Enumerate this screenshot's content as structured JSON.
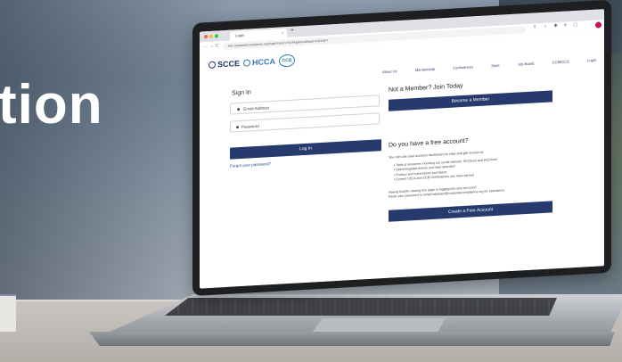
{
  "hero": {
    "word": "tion"
  },
  "browser": {
    "tab_title": "Login",
    "url": "hhc.corporatecompliance.org/login?return=%2Flogin&callback=HCANET",
    "nav_back": "←",
    "nav_forward": "→",
    "nav_reload": "C",
    "tool_icons": "⇪ ☆ ✱ ≡ ▢"
  },
  "logos": {
    "scce": "SCCE",
    "hcca": "HCCA",
    "ccb": "CCB"
  },
  "nav": [
    "About Us",
    "Membership",
    "Conferences",
    "Store",
    "Job Board",
    "CCB/ICCS",
    "Login"
  ],
  "signin": {
    "title": "Sign In",
    "email_placeholder": "Email Address",
    "password_placeholder": "Password",
    "login_button": "Log In",
    "forgot_link": "Forgot your password?"
  },
  "member": {
    "title": "Not a Member? Join Today",
    "button": "Become a Member"
  },
  "free_account": {
    "title": "Do you have a free account?",
    "intro": "You can use your account dashboard to view and get access to:",
    "bullets": [
      "Tools & resources including our social network, SCCEnet and HCCAnet",
      "Upcoming/past events you have attended",
      "Product and subscription purchases",
      "Current CEUs and CCB Certifications you have earned"
    ],
    "help_line1": "Having trouble viewing this page or logging into your account?",
    "help_line2": "Reset your password or email helpteam@corporatecompliance.org for assistance.",
    "button": "Create a Free Account"
  },
  "colors": {
    "navy": "#263a6e",
    "hcca_blue": "#3a74b8",
    "ccb_teal": "#2e7d9c"
  }
}
